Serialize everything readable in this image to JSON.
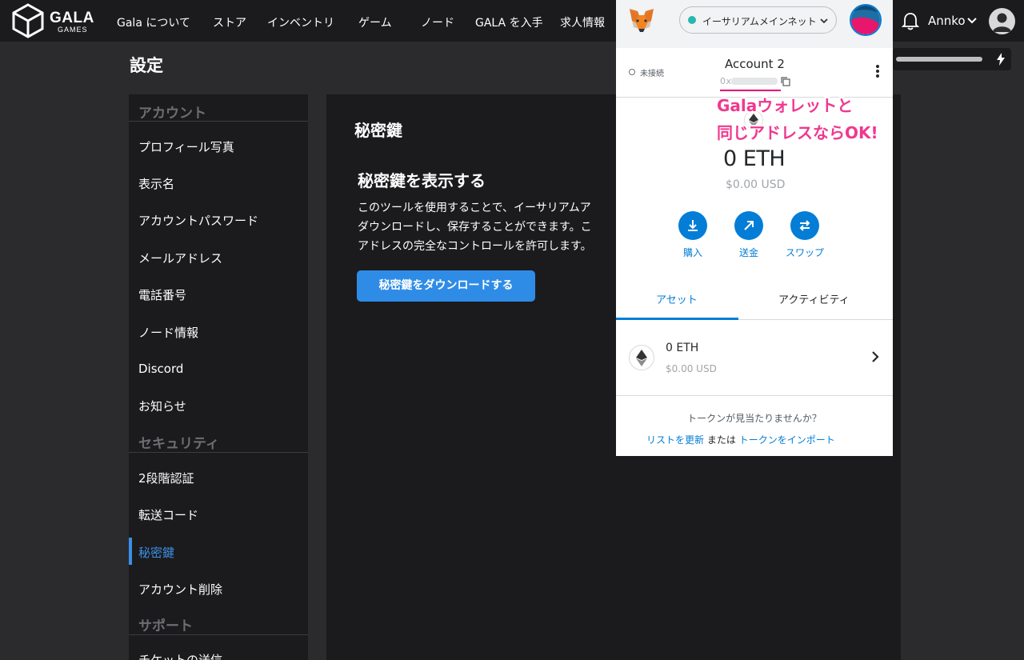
{
  "topnav": {
    "brand": "GALA",
    "brand_sub": "GAMES",
    "links": [
      "Gala について",
      "ストア",
      "インベントリ",
      "ゲーム",
      "ノード",
      "GALA を入手",
      "求人情報"
    ],
    "user_name": "Annko"
  },
  "page_title": "設定",
  "sidebar": {
    "account_section": "アカウント",
    "account_items": [
      "プロフィール写真",
      "表示名",
      "アカウントパスワード",
      "メールアドレス",
      "電話番号",
      "ノード情報",
      "Discord",
      "お知らせ"
    ],
    "security_section": "セキュリティ",
    "security_items": [
      "2段階認証",
      "転送コード",
      "秘密鍵",
      "アカウント削除"
    ],
    "support_section": "サポート",
    "support_items": [
      "チケットの送信"
    ],
    "active_item": "秘密鍵"
  },
  "main": {
    "heading": "秘密鍵",
    "subheading": "秘密鍵を表示する",
    "desc_lines": [
      "このツールを使用することで、イーサリアムア",
      "ダウンロードし、保存することができます。こ",
      "アドレスの完全なコントロールを許可します。"
    ],
    "download_button": "秘密鍵をダウンロードする"
  },
  "metamask": {
    "network": "イーサリアムメインネット",
    "connection_status": "未接続",
    "account_name": "Account 2",
    "address_prefix": "0x",
    "balance": "0 ETH",
    "balance_usd": "$0.00 USD",
    "actions": [
      {
        "label": "購入",
        "icon": "download-icon"
      },
      {
        "label": "送金",
        "icon": "arrow-up-right-icon"
      },
      {
        "label": "スワップ",
        "icon": "swap-icon"
      }
    ],
    "tabs": [
      "アセット",
      "アクティビティ"
    ],
    "asset": {
      "amount": "0 ETH",
      "usd": "$0.00 USD"
    },
    "missing_tokens": "トークンが見当たりませんか？",
    "refresh_link": "リストを更新",
    "or_text": "または",
    "import_link": "トークンをインポート"
  },
  "annotation": {
    "line1": "Galaウォレットと",
    "line2": "同じアドレスならOK!"
  },
  "colors": {
    "accent_blue": "#2f8ce6",
    "metamask_blue": "#037dd6",
    "annotation_pink": "#f0388f",
    "panel_dark": "#1b1b1d"
  }
}
